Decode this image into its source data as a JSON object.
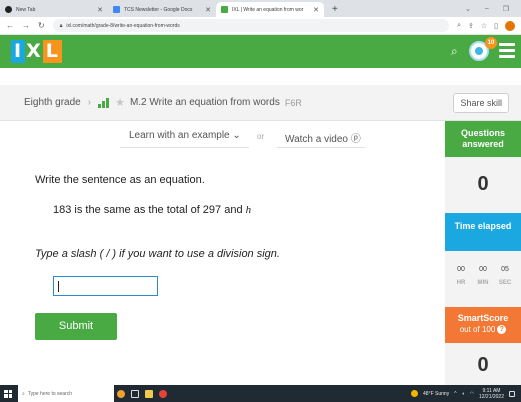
{
  "browser": {
    "tabs": [
      {
        "title": "New Tab",
        "icon": "github-icon",
        "active": false
      },
      {
        "title": "TCS Newsletter - Google Docs",
        "icon": "google-docs-icon",
        "active": false
      },
      {
        "title": "IXL | Write an equation from wor",
        "icon": "ixl-icon",
        "active": true
      }
    ],
    "url": "ixl.com/math/grade-8/write-an-equation-from-words"
  },
  "header": {
    "logo_letters": [
      "I",
      "X",
      "L"
    ],
    "notification_count": "10"
  },
  "breadcrumb": {
    "grade": "Eighth grade",
    "skill": "M.2 Write an equation from words",
    "code": "F6R",
    "share_label": "Share skill"
  },
  "help": {
    "learn_label": "Learn with an example",
    "or_label": "or",
    "watch_label": "Watch a video"
  },
  "question": {
    "instruction": "Write the sentence as an equation.",
    "sentence": "183 is the same as the total of 297 and",
    "variable": "h",
    "hint": "Type a slash ( / ) if you want to use a division sign.",
    "answer_value": "",
    "submit_label": "Submit"
  },
  "sidebar": {
    "questions_label": "Questions answered",
    "questions_count": "0",
    "time_label": "Time elapsed",
    "time": [
      {
        "value": "00",
        "unit": "HR"
      },
      {
        "value": "00",
        "unit": "MIN"
      },
      {
        "value": "05",
        "unit": "SEC"
      }
    ],
    "smartscore_label": "SmartScore",
    "smartscore_sub": "out of 100",
    "smartscore_value": "0"
  },
  "taskbar": {
    "search_placeholder": "Type here to search",
    "weather": "48°F Sunny",
    "time": "9:11 AM",
    "date": "12/21/2022"
  },
  "colors": {
    "ixl_green": "#49a942",
    "time_blue": "#1ba8e0",
    "smart_orange": "#f37835",
    "taskbar": "#1f2a33"
  }
}
